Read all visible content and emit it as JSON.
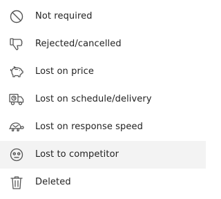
{
  "menu": {
    "items": [
      {
        "label": "Not required",
        "icon": "prohibited-icon"
      },
      {
        "label": "Rejected/cancelled",
        "icon": "thumbs-down-icon"
      },
      {
        "label": "Lost on price",
        "icon": "piggy-bank-icon"
      },
      {
        "label": "Lost on schedule/delivery",
        "icon": "delivery-truck-icon"
      },
      {
        "label": "Lost on response speed",
        "icon": "turtle-icon"
      },
      {
        "label": "Lost to competitor",
        "icon": "annoyed-face-icon",
        "highlighted": true
      },
      {
        "label": "Deleted",
        "icon": "trash-icon"
      }
    ]
  },
  "colors": {
    "text": "#222222",
    "icon": "#555555",
    "highlight_bg": "#f3f3f3"
  }
}
